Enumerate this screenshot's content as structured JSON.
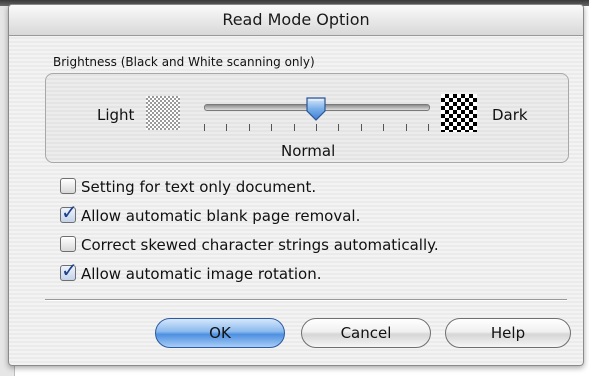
{
  "dialog": {
    "title": "Read Mode Option"
  },
  "brightness": {
    "group_label": "Brightness (Black and White scanning only)",
    "light_label": "Light",
    "dark_label": "Dark",
    "value_label": "Normal",
    "slider_position": 0.5,
    "tick_count": 11
  },
  "options": [
    {
      "label": "Setting for text only document.",
      "checked": false
    },
    {
      "label": "Allow automatic blank page removal.",
      "checked": true
    },
    {
      "label": "Correct skewed character strings automatically.",
      "checked": false
    },
    {
      "label": "Allow automatic image rotation.",
      "checked": true
    }
  ],
  "buttons": {
    "ok": "OK",
    "cancel": "Cancel",
    "help": "Help"
  },
  "colors": {
    "default_button": "#4d8fe0",
    "checkmark": "#1e3f8a"
  }
}
